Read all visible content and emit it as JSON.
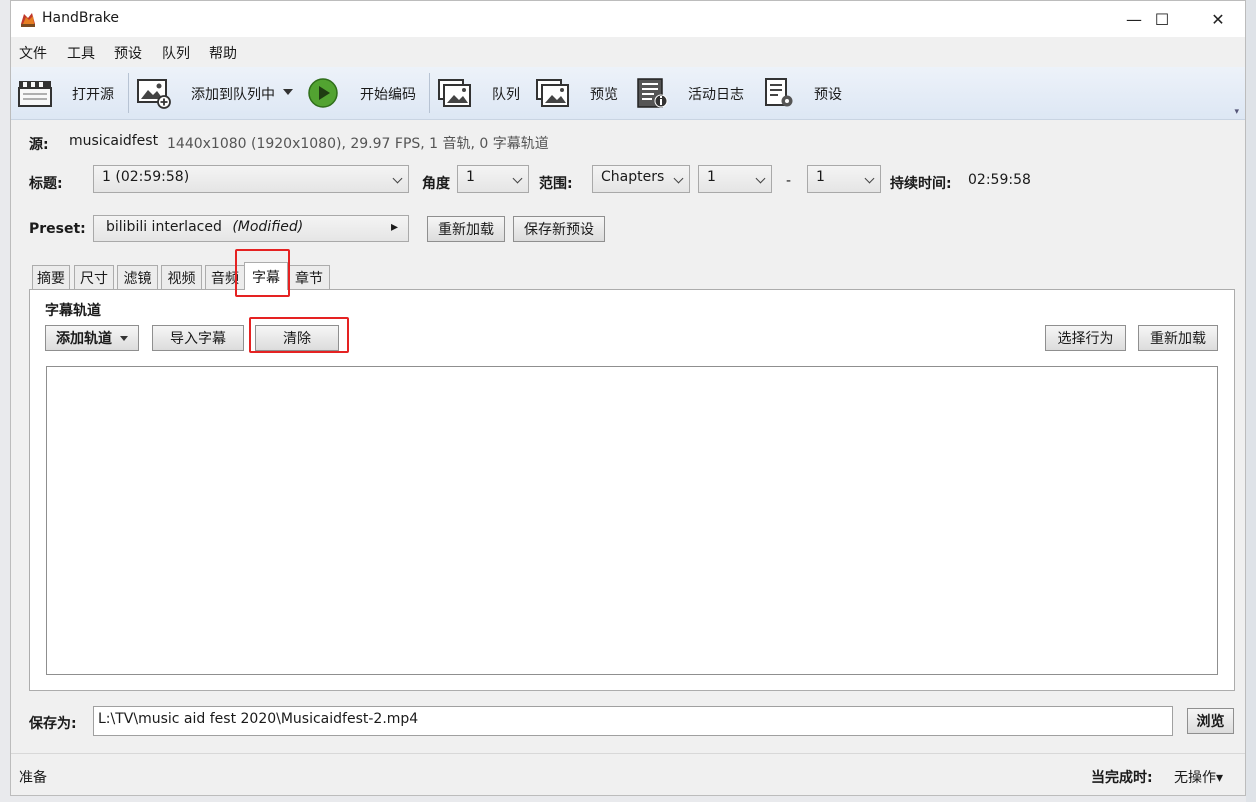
{
  "window": {
    "title": "HandBrake",
    "minimize": "—",
    "maximize": "☐",
    "close": "✕"
  },
  "menu": [
    "文件",
    "工具",
    "预设",
    "队列",
    "帮助"
  ],
  "toolbar": {
    "open_source": "打开源",
    "add_to_queue": "添加到队列中",
    "start_encode": "开始编码",
    "queue": "队列",
    "preview": "预览",
    "activity_log": "活动日志",
    "presets": "预设",
    "overflow": "▾"
  },
  "source": {
    "label": "源:",
    "name": "musicaidfest",
    "info": "1440x1080 (1920x1080), 29.97 FPS, 1 音轨, 0 字幕轨道"
  },
  "title_row": {
    "title_label": "标题:",
    "title_value": "1  (02:59:58)",
    "angle_label": "角度",
    "angle_value": "1",
    "range_label": "范围:",
    "range_type": "Chapters",
    "range_start": "1",
    "range_dash": "-",
    "range_end": "1",
    "duration_label": "持续时间:",
    "duration_value": "02:59:58"
  },
  "preset": {
    "label": "Preset:",
    "name": "bilibili interlaced",
    "modified": "(Modified)",
    "arrow": "▸",
    "reload": "重新加载",
    "save_new": "保存新预设"
  },
  "tabs": [
    "摘要",
    "尺寸",
    "滤镜",
    "视频",
    "音频",
    "字幕",
    "章节"
  ],
  "active_tab": "字幕",
  "subtitles": {
    "section_title": "字幕轨道",
    "add_track": "添加轨道",
    "import": "导入字幕",
    "clear": "清除",
    "select_behavior": "选择行为",
    "reload": "重新加载"
  },
  "save_as": {
    "label": "保存为:",
    "path": "L:\\TV\\music aid fest 2020\\Musicaidfest-2.mp4",
    "browse": "浏览"
  },
  "status": {
    "text": "准备",
    "when_done_label": "当完成时:",
    "when_done_value": "无操作",
    "when_done_caret": "▾"
  },
  "colors": {
    "highlight": "#e52222",
    "play_button": "#52a331",
    "toolbar_bg": "#e4ebf5"
  }
}
